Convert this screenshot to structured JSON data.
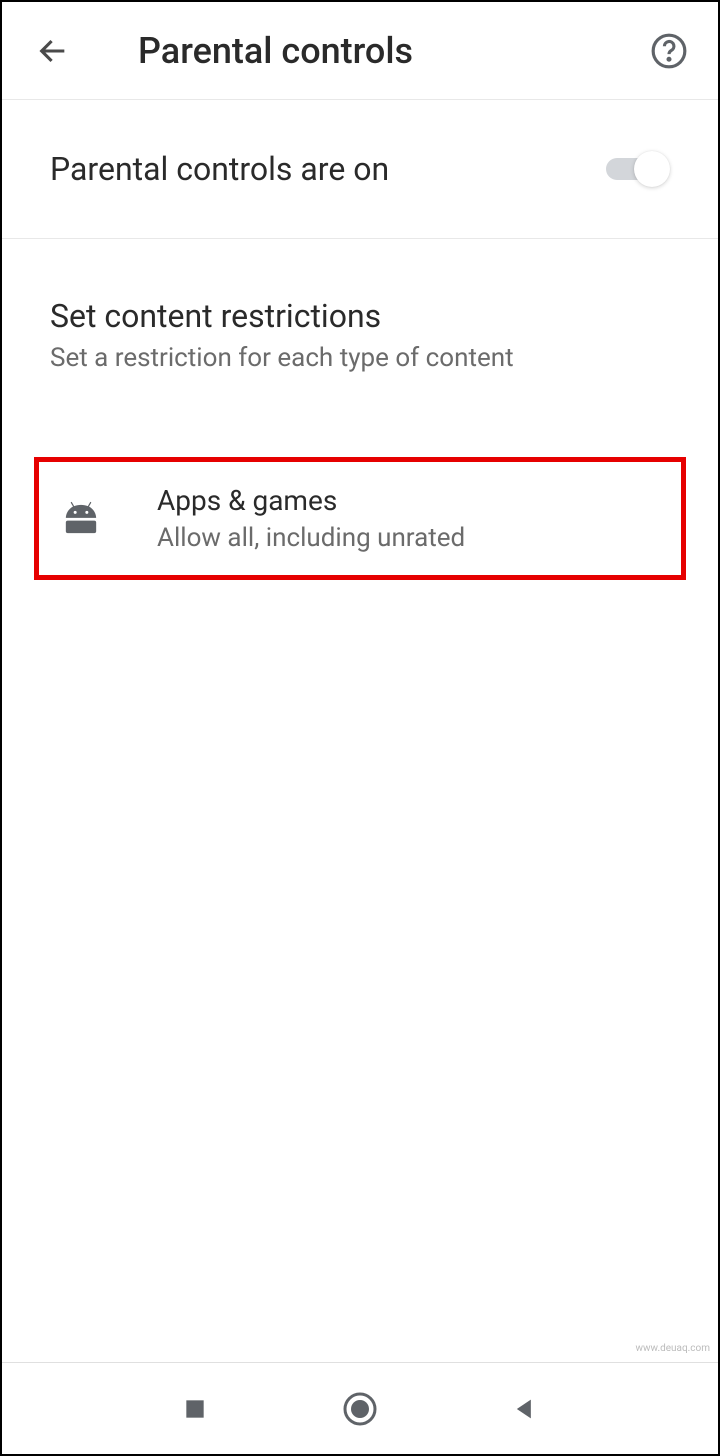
{
  "header": {
    "title": "Parental controls"
  },
  "toggle": {
    "label": "Parental controls are on",
    "enabled": true
  },
  "section": {
    "title": "Set content restrictions",
    "subtitle": "Set a restriction for each type of content"
  },
  "items": [
    {
      "title": "Apps & games",
      "subtitle": "Allow all, including unrated"
    }
  ],
  "watermark": "www.deuaq.com"
}
